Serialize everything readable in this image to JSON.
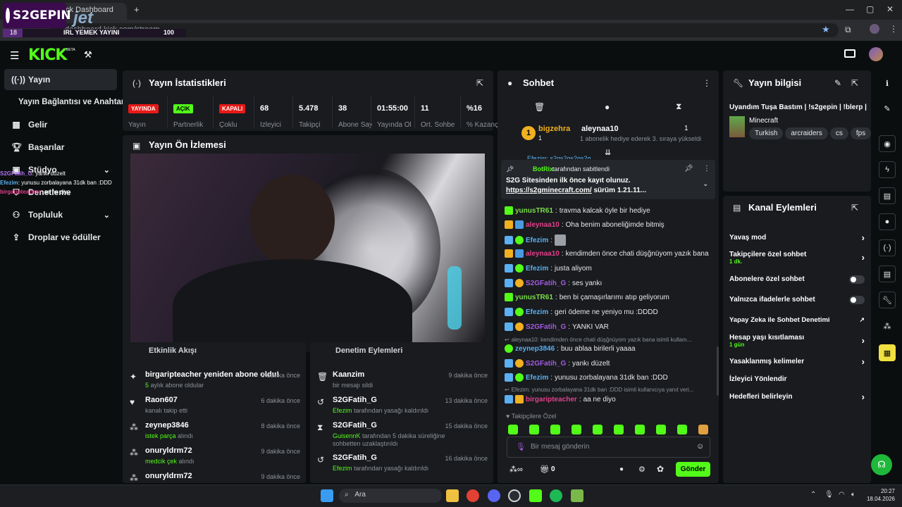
{
  "browser": {
    "tab_title": "Stream - Kick Dashboard",
    "url": "dashboard.kick.com/stream",
    "new_tab": "+"
  },
  "overlay": {
    "brand": "S2GEPIN",
    "sponsor": "jet",
    "left_num": "18",
    "bar_label": "IRL YEMEK YAYINI",
    "right_num": "100",
    "chat_lines": [
      {
        "user": "S2GFatih_G",
        "text": "yankı düzelt"
      },
      {
        "user": "Efezim",
        "text": "yunusu zorbalayana 31dk ban :DDD"
      },
      {
        "user": "birgaripteacher",
        "text": "aa ne diyo"
      }
    ]
  },
  "header": {
    "logo": "KICK",
    "beta": "BETA"
  },
  "sidebar": {
    "items": [
      {
        "label": "Yayın",
        "icon": "broadcast-icon"
      },
      {
        "label": "Yayın Bağlantısı ve Anahtarı",
        "icon": ""
      },
      {
        "label": "Gelir",
        "icon": "revenue-icon"
      },
      {
        "label": "Başarılar",
        "icon": "trophy-icon"
      },
      {
        "label": "Stüdyo",
        "icon": "studio-icon"
      },
      {
        "label": "Denetleme",
        "icon": "moderation-icon"
      },
      {
        "label": "Topluluk",
        "icon": "community-icon"
      },
      {
        "label": "Droplar ve ödüller",
        "icon": "drops-icon"
      }
    ]
  },
  "stats": {
    "title": "Yayın İstatistikleri",
    "cells": [
      {
        "value": "YAYINDA",
        "label": "Yayın",
        "color": "#e91916"
      },
      {
        "value": "AÇIK",
        "label": "Partnerlik",
        "color": "#53fc18"
      },
      {
        "value": "KAPALI",
        "label": "Çoklu",
        "color": "#e91916"
      },
      {
        "value": "68",
        "label": "İzleyici"
      },
      {
        "value": "5.478",
        "label": "Takipçi"
      },
      {
        "value": "38",
        "label": "Abone Sayısı"
      },
      {
        "value": "01:55:00",
        "label": "Yayında Olduğu"
      },
      {
        "value": "11",
        "label": "Ort. Sohbette"
      },
      {
        "value": "%16",
        "label": "% Kazanç"
      }
    ]
  },
  "preview": {
    "title": "Yayın Ön İzlemesi"
  },
  "activity": {
    "title": "Etkinlik Akışı",
    "rows": [
      {
        "title": "birgaripteacher yeniden abone oldu!",
        "sub_hl": "5",
        "sub": " aylık abone oldular",
        "time": "6 dakika önce",
        "icon": "star-icon"
      },
      {
        "title": "Raon607",
        "sub_hl": "",
        "sub": "kanalı takip etti",
        "time": "6 dakika önce",
        "icon": "heart-icon"
      },
      {
        "title": "zeynep3846",
        "sub_hl": "istek parça",
        "sub": " alındı",
        "time": "8 dakika önce",
        "icon": "points-icon"
      },
      {
        "title": "onuryldrm72",
        "sub_hl": "medcik çek",
        "sub": " alındı",
        "time": "9 dakika önce",
        "icon": "points-icon"
      },
      {
        "title": "onuryldrm72",
        "sub_hl": "",
        "sub": "",
        "time": "9 dakika önce",
        "icon": "points-icon"
      }
    ]
  },
  "modlog": {
    "title": "Denetim Eylemleri",
    "rows": [
      {
        "title": "Kaanzim",
        "sub_hl": "",
        "sub": "bir mesajı sildi",
        "time": "9 dakika önce",
        "icon": "trash-icon"
      },
      {
        "title": "S2GFatih_G",
        "sub_hl": "Efezim",
        "sub": " tarafından yasağı kaldırıldı",
        "time": "13 dakika önce",
        "icon": "undo-icon"
      },
      {
        "title": "S2GFatih_G",
        "sub_hl": "GuisennK",
        "sub": " tarafından 5 dakika süreliğine sohbetten uzaklaştırıldı",
        "time": "15 dakika önce",
        "icon": "hourglass-icon"
      },
      {
        "title": "S2GFatih_G",
        "sub_hl": "Efezim",
        "sub": " tarafından yasağı kaldırıldı",
        "time": "16 dakika önce",
        "icon": "undo-icon"
      }
    ]
  },
  "chat": {
    "title": "Sohbet",
    "sub_banner": {
      "user1": "bigzehra",
      "count1": "1",
      "user2": "aleynaa10",
      "count2": "1",
      "text": "1 abonelik hediye ederek 3. sıraya yükseldi"
    },
    "partial_line": "Efezim: s2gs2gs2gs2g",
    "pinned": {
      "by": "BotRix",
      "by_suffix": "tarafından sabitlendi",
      "text": "S2G Sitesinden ilk önce kayıt olunuz.",
      "link": "https://s2gminecraft.com/",
      "link_suffix": " sürüm 1.21.11..."
    },
    "messages": [
      {
        "user": "yunusTR61",
        "color": "#7cdc4c",
        "text": "travma kalcak öyle bir hediye"
      },
      {
        "user": "aleynaa10",
        "color": "#e0408a",
        "text": "Oha benim aboneliğimde bitmiş"
      },
      {
        "user": "Efezim",
        "color": "#5ab0f0",
        "text": ""
      },
      {
        "user": "aleynaa10",
        "color": "#e0408a",
        "text": "kendimden önce chati düşğnüyom yazık bana"
      },
      {
        "user": "Efezim",
        "color": "#5ab0f0",
        "text": "justa aliyom"
      },
      {
        "user": "S2GFatih_G",
        "color": "#a35ae0",
        "text": "ses yankı"
      },
      {
        "user": "yunusTR61",
        "color": "#7cdc4c",
        "text": "ben bi çamaşırlarımı atıp geliyorum"
      },
      {
        "user": "Efezim",
        "color": "#5ab0f0",
        "text": "geri ödeme ne yeniyo mu :DDDD"
      },
      {
        "user": "S2GFatih_G",
        "color": "#a35ae0",
        "text": "YANKI VAR"
      },
      {
        "user": "zeynep3846",
        "color": "#5ab0f0",
        "text": "buu ablaa birilerli yaaaa"
      },
      {
        "user": "S2GFatih_G",
        "color": "#a35ae0",
        "text": "yankı düzelt"
      },
      {
        "user": "Efezim",
        "color": "#5ab0f0",
        "text": "yunusu zorbalayana 31dk ban :DDD"
      },
      {
        "user": "birgaripteacher",
        "color": "#e0408a",
        "text": "aa ne diyo"
      }
    ],
    "reply1": "aleynaa10: kendimden önce chati düşğnüyom yazık bana isimli kullanı...",
    "reply2": "Efezim: yunusu zorbalayana 31dk ban :DDD isimli kullanıcıya yanıt veri...",
    "emote_label": "Takipçilere Özel",
    "input_placeholder": "Bir mesaj gönderin",
    "points": "0",
    "send_label": "Gönder"
  },
  "stream_info": {
    "title": "Yayın bilgisi",
    "stream_title": "Uyandım Tuşa Bastım | !s2gepin | !blerp |",
    "category": "Minecraft",
    "tags": [
      "Turkish",
      "arcraiders",
      "cs",
      "fps"
    ]
  },
  "channel_actions": {
    "title": "Kanal Eylemleri",
    "rows": [
      {
        "label": "Yavaş mod",
        "sub": "",
        "control": "chevron"
      },
      {
        "label": "Takipçilere özel sohbet",
        "sub": "1 dk.",
        "control": "chevron"
      },
      {
        "label": "Abonelere özel sohbet",
        "sub": "",
        "control": "toggle"
      },
      {
        "label": "Yalnızca ifadelerle sohbet",
        "sub": "",
        "control": "toggle"
      },
      {
        "label": "Yapay Zeka ile Sohbet Denetimi",
        "sub": "",
        "control": "external"
      },
      {
        "label": "Hesap yaşı kısıtlaması",
        "sub": "1 gün",
        "control": "chevron"
      },
      {
        "label": "Yasaklanmış kelimeler",
        "sub": "",
        "control": "chevron"
      },
      {
        "label": "İzleyici Yönlendir",
        "sub": "",
        "control": "none"
      },
      {
        "label": "Hedefleri belirleyin",
        "sub": "",
        "control": "chevron"
      }
    ]
  },
  "taskbar": {
    "search": "Ara",
    "time": "20:27",
    "date": "18.04.2026"
  }
}
